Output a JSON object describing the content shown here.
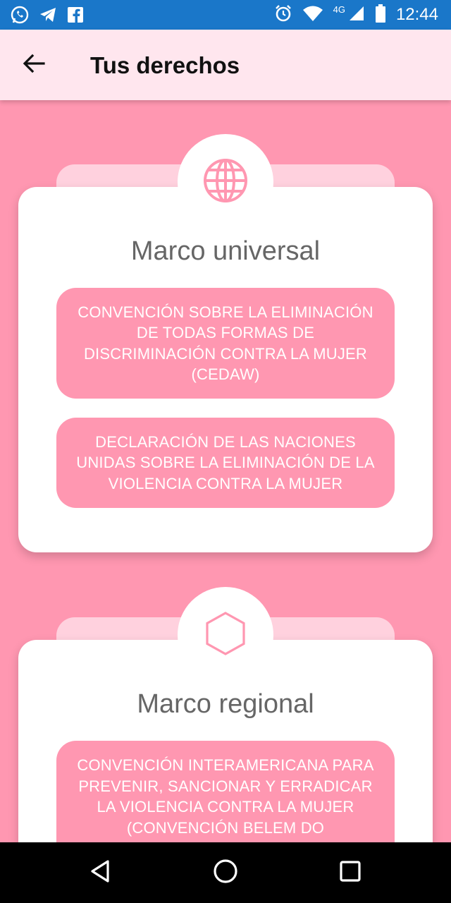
{
  "status_bar": {
    "time": "12:44",
    "network": "4G",
    "left_icons": [
      "whatsapp-icon",
      "telegram-icon",
      "facebook-icon"
    ],
    "right_icons": [
      "alarm-icon",
      "wifi-icon",
      "signal-icon",
      "battery-icon"
    ]
  },
  "app_bar": {
    "title": "Tus derechos",
    "back_icon": "arrow-left-icon",
    "background": "#ffe6ee"
  },
  "sections": [
    {
      "title": "Marco universal",
      "icon": "globe-icon",
      "items": [
        "CONVENCIÓN SOBRE LA ELIMINACIÓN DE TODAS FORMAS DE DISCRIMINACIÓN CONTRA LA MUJER (CEDAW)",
        "DECLARACIÓN DE LAS NACIONES UNIDAS SOBRE LA ELIMINACIÓN DE LA VIOLENCIA CONTRA LA MUJER"
      ]
    },
    {
      "title": "Marco regional",
      "icon": "hexagon-icon",
      "items": [
        "CONVENCIÓN INTERAMERICANA PARA PREVENIR, SANCIONAR Y ERRADICAR LA VIOLENCIA CONTRA LA MUJER (CONVENCIÓN BELEM DO"
      ]
    }
  ],
  "colors": {
    "status_bar": "#1a77c9",
    "page_background": "#ff97b1",
    "button_background": "#ff97b1",
    "card_tab": "#ffd1de",
    "icon_pink": "#ff97b1"
  },
  "nav_bar": {
    "icons": [
      "back-triangle-icon",
      "home-circle-icon",
      "recents-square-icon"
    ]
  }
}
